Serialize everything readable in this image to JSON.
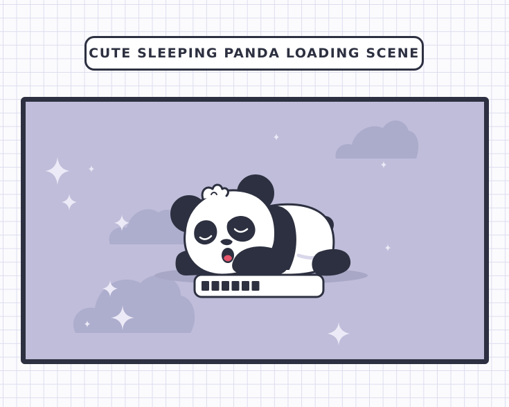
{
  "title": "CUTE SLEEPING PANDA LOADING SCENE",
  "loading": {
    "filled_segments": 6,
    "progress": 0.52
  },
  "colors": {
    "outline": "#2d3040",
    "scene_background": "#bfbdd9",
    "cloud": "#ababcb",
    "sparkle": "#eceaf7",
    "panda_white": "#ffffff",
    "panda_black": "#2d3040",
    "mouth": "#e5556b",
    "shadow": "#a8a7c6",
    "loading_bar_fill": "#ffffff"
  },
  "icons": [
    "cloud-icon",
    "sparkle-icon",
    "panda-illustration",
    "loading-bar"
  ]
}
